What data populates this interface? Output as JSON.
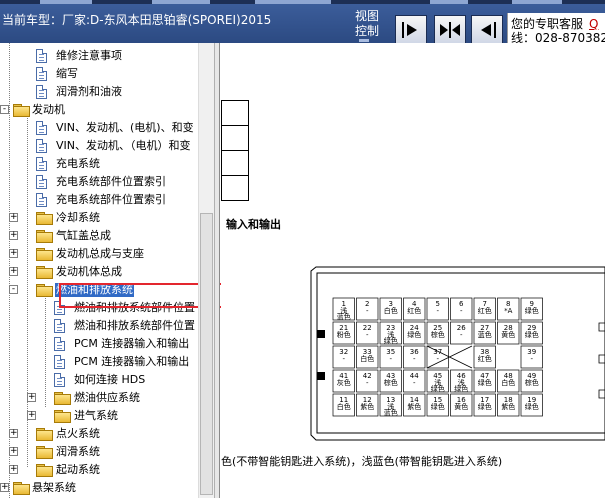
{
  "header": {
    "car_model": "当前车型：厂家:D-东风本田思铂睿(SPOREI)2015",
    "view_control_line1": "视图",
    "view_control_line2": "控制",
    "service_line1": "您的专职客服",
    "service_link": "Q",
    "service_phone": "线：028-870382("
  },
  "tree": [
    {
      "level": 2,
      "type": "doc",
      "label": "维修注意事项"
    },
    {
      "level": 2,
      "type": "doc",
      "label": "缩写"
    },
    {
      "level": 2,
      "type": "doc",
      "label": "润滑剂和油液"
    },
    {
      "level": 1,
      "type": "folder",
      "toggle": "-",
      "label": "发动机"
    },
    {
      "level": 2,
      "type": "doc",
      "label": "VIN、发动机、(电机)、和变"
    },
    {
      "level": 2,
      "type": "doc",
      "label": "VIN、发动机、（电机）和变"
    },
    {
      "level": 2,
      "type": "doc",
      "label": "充电系统"
    },
    {
      "level": 2,
      "type": "doc",
      "label": "充电系统部件位置索引"
    },
    {
      "level": 2,
      "type": "doc",
      "label": "充电系统部件位置索引"
    },
    {
      "level": 2,
      "type": "folder",
      "toggle": "+",
      "label": "冷却系统"
    },
    {
      "level": 2,
      "type": "folder",
      "toggle": "+",
      "label": "气缸盖总成"
    },
    {
      "level": 2,
      "type": "folder",
      "toggle": "+",
      "label": "发动机总成与支座"
    },
    {
      "level": 2,
      "type": "folder",
      "toggle": "+",
      "label": "发动机体总成"
    },
    {
      "level": 2,
      "type": "folder",
      "toggle": "-",
      "label": "燃油和排放系统",
      "selected": true
    },
    {
      "level": 3,
      "type": "doc",
      "label": "燃油和排放系统部件位置"
    },
    {
      "level": 3,
      "type": "doc",
      "label": "燃油和排放系统部件位置"
    },
    {
      "level": 3,
      "type": "doc",
      "label": "PCM 连接器输入和输出"
    },
    {
      "level": 3,
      "type": "doc",
      "label": "PCM 连接器输入和输出"
    },
    {
      "level": 3,
      "type": "doc",
      "label": "如何连接 HDS"
    },
    {
      "level": 3,
      "type": "folder",
      "toggle": "+",
      "label": "燃油供应系统"
    },
    {
      "level": 3,
      "type": "folder",
      "toggle": "+",
      "label": "进气系统"
    },
    {
      "level": 2,
      "type": "folder",
      "toggle": "+",
      "label": "点火系统"
    },
    {
      "level": 2,
      "type": "folder",
      "toggle": "+",
      "label": "润滑系统"
    },
    {
      "level": 2,
      "type": "folder",
      "toggle": "+",
      "label": "起动系统"
    },
    {
      "level": 1,
      "type": "folder",
      "toggle": "+",
      "label": "悬架系统"
    },
    {
      "level": 1,
      "type": "folder",
      "toggle": "+",
      "label": "制动器"
    }
  ],
  "content": {
    "section_title": "输入和输出",
    "footer_note": "色(不带智能钥匙进入系统)，浅蓝色(带智能钥匙进入系统)",
    "pins": [
      {
        "n": "1",
        "c": "浅\n蓝色"
      },
      {
        "n": "2",
        "c": "-"
      },
      {
        "n": "3",
        "c": "白色"
      },
      {
        "n": "4",
        "c": "红色"
      },
      {
        "n": "5",
        "c": "-"
      },
      {
        "n": "6",
        "c": "-"
      },
      {
        "n": "7",
        "c": "红色"
      },
      {
        "n": "8",
        "c": "*A"
      },
      {
        "n": "9",
        "c": "绿色"
      },
      {
        "n": "21",
        "c": "粉色"
      },
      {
        "n": "22",
        "c": "-"
      },
      {
        "n": "23",
        "c": "浅\n绿色"
      },
      {
        "n": "24",
        "c": "绿色"
      },
      {
        "n": "25",
        "c": "棕色"
      },
      {
        "n": "26",
        "c": "-"
      },
      {
        "n": "27",
        "c": "蓝色"
      },
      {
        "n": "28",
        "c": "黄色"
      },
      {
        "n": "29",
        "c": "绿色"
      },
      {
        "n": "32",
        "c": "-"
      },
      {
        "n": "33",
        "c": "白色"
      },
      {
        "n": "35",
        "c": "-"
      },
      {
        "n": "36",
        "c": "-"
      },
      {
        "n": "37",
        "c": "-"
      },
      {
        "n": "38",
        "c": "红色"
      },
      {
        "n": "39",
        "c": "-"
      },
      {
        "n": "41",
        "c": "灰色"
      },
      {
        "n": "42",
        "c": "-"
      },
      {
        "n": "43",
        "c": "棕色"
      },
      {
        "n": "44",
        "c": "-"
      },
      {
        "n": "45",
        "c": "浅\n绿色"
      },
      {
        "n": "46",
        "c": "浅\n绿色"
      },
      {
        "n": "47",
        "c": "绿色"
      },
      {
        "n": "48",
        "c": "白色"
      },
      {
        "n": "49",
        "c": "棕色"
      },
      {
        "n": "11",
        "c": "白色"
      },
      {
        "n": "12",
        "c": "紫色"
      },
      {
        "n": "13",
        "c": "浅\n蓝色"
      },
      {
        "n": "14",
        "c": "紫色"
      },
      {
        "n": "15",
        "c": "绿色"
      },
      {
        "n": "16",
        "c": "黄色"
      },
      {
        "n": "17",
        "c": "绿色"
      },
      {
        "n": "18",
        "c": "紫色"
      },
      {
        "n": "19",
        "c": "绿色"
      }
    ]
  }
}
